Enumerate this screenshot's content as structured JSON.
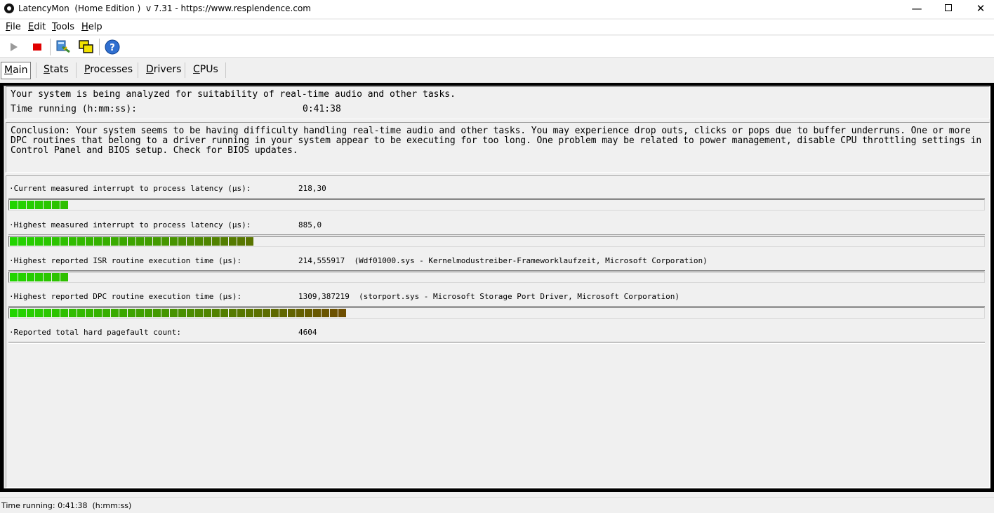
{
  "window": {
    "title": "LatencyMon  (Home Edition )  v 7.31 - https://www.resplendence.com",
    "minimize": "—",
    "close": "✕"
  },
  "menu": [
    {
      "label": "File",
      "key": "F",
      "rest": "ile"
    },
    {
      "label": "Edit",
      "key": "E",
      "rest": "dit"
    },
    {
      "label": "Tools",
      "key": "T",
      "rest": "ools"
    },
    {
      "label": "Help",
      "key": "H",
      "rest": "elp"
    }
  ],
  "toolbar": {
    "icons": [
      "play-icon",
      "stop-icon",
      "analyze-icon",
      "windows-icon",
      "help-icon"
    ],
    "help_glyph": "?"
  },
  "tabs": [
    {
      "label": "Main",
      "key": "M",
      "rest": "ain",
      "active": true
    },
    {
      "label": "Stats",
      "key": "S",
      "rest": "tats"
    },
    {
      "label": "Processes",
      "key": "P",
      "rest": "rocesses"
    },
    {
      "label": "Drivers",
      "key": "D",
      "rest": "rivers"
    },
    {
      "label": "CPUs",
      "key": "C",
      "rest": "PUs"
    }
  ],
  "main": {
    "analyze_text": "Your system is being analyzed for suitability of real-time audio and other tasks.",
    "time_label": "Time running (h:mm:ss):",
    "time_value": "0:41:38",
    "conclusion": "Conclusion: Your system seems to be having difficulty handling real-time audio and other tasks. You may experience drop outs, clicks or pops due to buffer underruns. One or more DPC routines that belong to a driver running in your system appear to be executing for too long. One problem may be related to power management, disable CPU throttling settings in Control Panel and BIOS setup. Check for BIOS updates."
  },
  "metrics": [
    {
      "label": "·Current measured interrupt to process latency (µs):",
      "value": "218,30",
      "segments": 7
    },
    {
      "label": "·Highest measured interrupt to process latency (µs):",
      "value": "885,0",
      "segments": 29
    },
    {
      "label": "·Highest reported ISR routine execution time (µs):",
      "value": "214,555917  (Wdf01000.sys - Kernelmodustreiber-Frameworklaufzeit, Microsoft Corporation)",
      "segments": 7
    },
    {
      "label": "·Highest reported DPC routine execution time (µs):",
      "value": "1309,387219  (storport.sys - Microsoft Storage Port Driver, Microsoft Corporation)",
      "segments": 40
    },
    {
      "label": "·Reported total hard pagefault count:",
      "value": "4604",
      "segments": 0
    }
  ],
  "colors": {
    "bar_start": "#22d400",
    "bar_end": "#6e4e00",
    "stop": "#e00000"
  },
  "status": {
    "text": "Time running: 0:41:38  (h:mm:ss)"
  }
}
